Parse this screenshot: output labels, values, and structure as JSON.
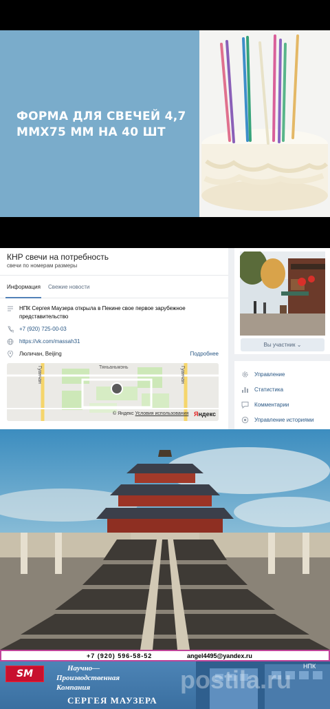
{
  "banner": {
    "title": "Форма для свечей 4,7 ммх75 мм на 40 шт"
  },
  "vk": {
    "group_title": "КНР свечи на потребность",
    "group_subtitle": "свечи по номерам размеры",
    "tabs": [
      {
        "label": "Информация",
        "active": true
      },
      {
        "label": "Свежие новости",
        "active": false
      }
    ],
    "description": "НПК Сергея Маузера открыла в Пекине свое первое зарубежное",
    "description_line2": "представительство",
    "phone": "+7 (920) 725-00-03",
    "website": "https://vk.com/massah31",
    "location": "Люличан, Beijing",
    "more_link": "Подробнее",
    "map": {
      "street_labels": [
        "Гуанчан",
        "Гуанчан",
        "Тяньаньмэнь"
      ],
      "copyright": "© Яндекс",
      "terms_link": "Условия использования",
      "logo_first": "Я",
      "logo_rest": "ндекс"
    },
    "member_button": "Вы участник",
    "menu": [
      {
        "label": "Управление",
        "icon": "gear-icon"
      },
      {
        "label": "Статистика",
        "icon": "stats-icon"
      },
      {
        "label": "Комментарии",
        "icon": "comment-icon"
      },
      {
        "label": "Управление историями",
        "icon": "stories-icon"
      }
    ]
  },
  "footer": {
    "phone": "+7 (920) 596-58-52",
    "email": "angel4495@yandex.ru",
    "logo_text": "SM",
    "company_line1": "Научно—",
    "company_line2": "Производственная",
    "company_line3": "Компания",
    "company_name": "СЕРГЕЯ    МАУЗЕРА",
    "npk_label": "НПК",
    "watermark": "postila.ru"
  },
  "colors": {
    "banner_blue": "#7aaccb",
    "vk_link": "#2a5885",
    "contact_border": "#c0449a",
    "company_blue": "#3a6fa0"
  }
}
